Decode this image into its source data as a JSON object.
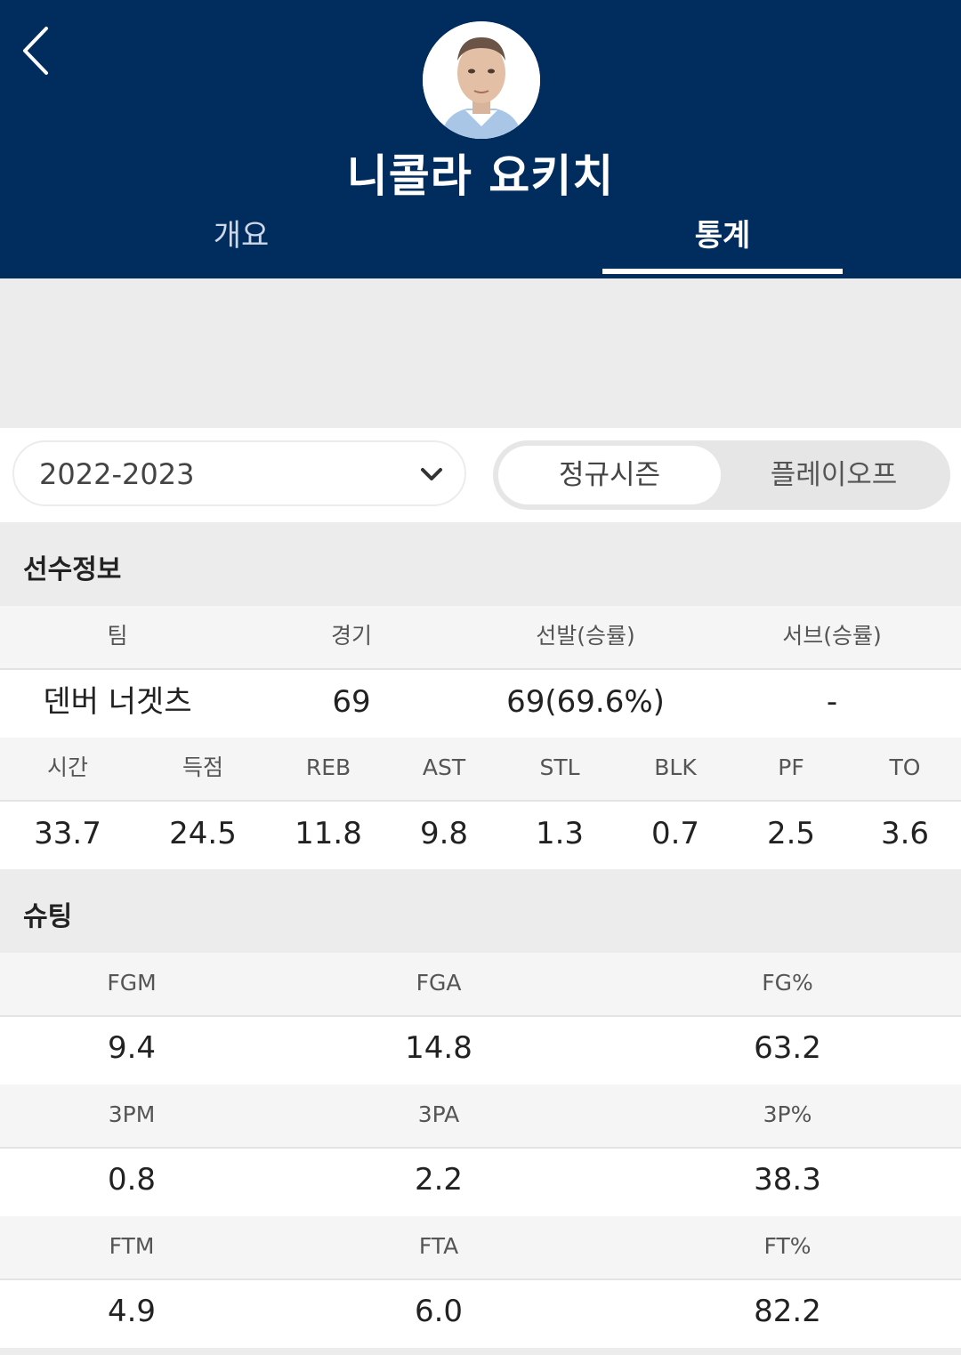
{
  "header": {
    "player_name": "니콜라 요키치",
    "tabs": [
      {
        "label": "개요",
        "active": false
      },
      {
        "label": "통계",
        "active": true
      }
    ]
  },
  "controls": {
    "season": "2022-2023",
    "season_type_options": [
      "정규시즌",
      "플레이오프"
    ],
    "selected_season_type": "정규시즌"
  },
  "player_info": {
    "title": "선수정보",
    "headers": [
      "팀",
      "경기",
      "선발(승률)",
      "서브(승률)"
    ],
    "values": [
      "덴버 너겟츠",
      "69",
      "69(69.6%)",
      "-"
    ],
    "stat_headers": [
      "시간",
      "득점",
      "REB",
      "AST",
      "STL",
      "BLK",
      "PF",
      "TO"
    ],
    "stat_values": [
      "33.7",
      "24.5",
      "11.8",
      "9.8",
      "1.3",
      "0.7",
      "2.5",
      "3.6"
    ]
  },
  "shooting": {
    "title": "슈팅",
    "rows": [
      {
        "headers": [
          "FGM",
          "FGA",
          "FG%"
        ],
        "values": [
          "9.4",
          "14.8",
          "63.2"
        ]
      },
      {
        "headers": [
          "3PM",
          "3PA",
          "3P%"
        ],
        "values": [
          "0.8",
          "2.2",
          "38.3"
        ]
      },
      {
        "headers": [
          "FTM",
          "FTA",
          "FT%"
        ],
        "values": [
          "4.9",
          "6.0",
          "82.2"
        ]
      }
    ]
  },
  "colors": {
    "header_bg": "#002d5e",
    "page_bg": "#ececec"
  }
}
